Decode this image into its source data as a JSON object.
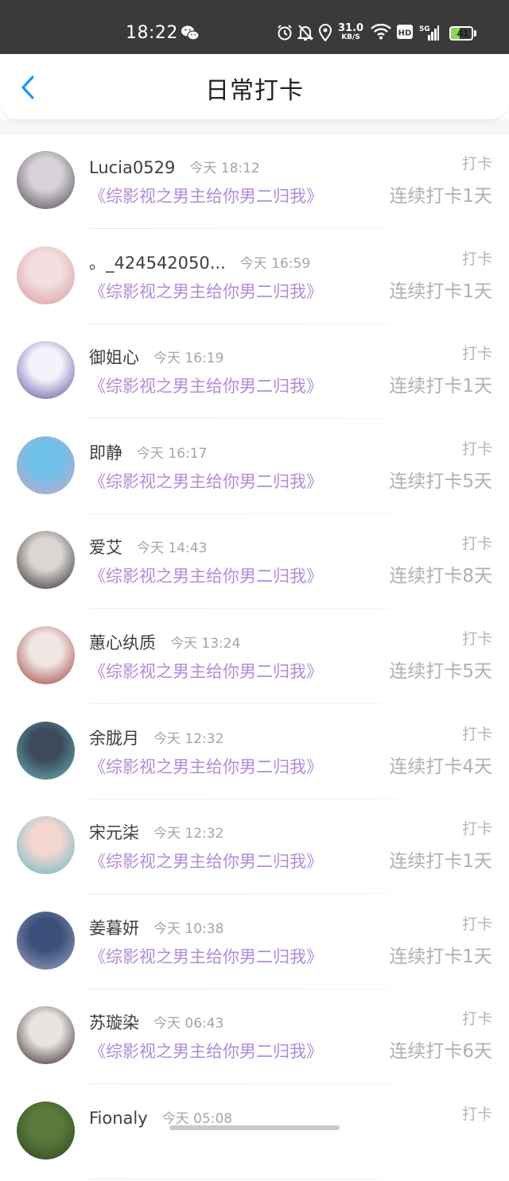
{
  "status_bar": {
    "time": "18:22",
    "net_speed_value": "31.0",
    "net_speed_unit": "KB/S",
    "network_type": "5G",
    "hd_label": "HD",
    "battery_level": "41",
    "battery_fraction": 0.41,
    "icons": [
      "wechat-icon",
      "alarm-icon",
      "mute-bell-icon",
      "location-icon",
      "wifi-icon",
      "hd-icon",
      "signal-icon",
      "battery-icon"
    ]
  },
  "nav": {
    "title": "日常打卡",
    "back_icon": "chevron-left-icon",
    "accent_color": "#2196f3"
  },
  "colors": {
    "book_title": "#b28bd8",
    "secondary_text": "#a5a5a5"
  },
  "entries": [
    {
      "name": "Lucia0529",
      "time": "今天 18:12",
      "book": "《综影视之男主给你男二归我》",
      "action": "打卡",
      "streak": "连续打卡1天",
      "avatar_colors": [
        "#d7d3d8",
        "#4b4550"
      ]
    },
    {
      "name": "。_424542050...",
      "time": "今天 16:59",
      "book": "《综影视之男主给你男二归我》",
      "action": "打卡",
      "streak": "连续打卡1天",
      "avatar_colors": [
        "#f3dfe0",
        "#d6969d"
      ]
    },
    {
      "name": "御姐心",
      "time": "今天 16:19",
      "book": "《综影视之男主给你男二归我》",
      "action": "打卡",
      "streak": "连续打卡1天",
      "avatar_colors": [
        "#f4f3fb",
        "#5b4a9a"
      ]
    },
    {
      "name": "即静",
      "time": "今天 16:17",
      "book": "《综影视之男主给你男二归我》",
      "action": "打卡",
      "streak": "连续打卡5天",
      "avatar_colors": [
        "#6fc0e8",
        "#c7a6c8"
      ]
    },
    {
      "name": "爱艾",
      "time": "今天 14:43",
      "book": "《综影视之男主给你男二归我》",
      "action": "打卡",
      "streak": "连续打卡8天",
      "avatar_colors": [
        "#d9d6d4",
        "#2a2625"
      ]
    },
    {
      "name": "蕙心纨质",
      "time": "今天 13:24",
      "book": "《综影视之男主给你男二归我》",
      "action": "打卡",
      "streak": "连续打卡5天",
      "avatar_colors": [
        "#f0e6e4",
        "#9b3a36"
      ]
    },
    {
      "name": "余胧月",
      "time": "今天 12:32",
      "book": "《综影视之男主给你男二归我》",
      "action": "打卡",
      "streak": "连续打卡4天",
      "avatar_colors": [
        "#3c4a5c",
        "#6db5b7"
      ]
    },
    {
      "name": "宋元柒",
      "time": "今天 12:32",
      "book": "《综影视之男主给你男二归我》",
      "action": "打卡",
      "streak": "连续打卡1天",
      "avatar_colors": [
        "#f2d6cf",
        "#5fb8c6"
      ]
    },
    {
      "name": "姜暮妍",
      "time": "今天 10:38",
      "book": "《综影视之男主给你男二归我》",
      "action": "打卡",
      "streak": "连续打卡1天",
      "avatar_colors": [
        "#3b4f7a",
        "#9aa6c2"
      ]
    },
    {
      "name": "苏璇染",
      "time": "今天 06:43",
      "book": "《综影视之男主给你男二归我》",
      "action": "打卡",
      "streak": "连续打卡6天",
      "avatar_colors": [
        "#e9e3e1",
        "#2b2323"
      ]
    },
    {
      "name": "Fionaly",
      "time": "今天 05:08",
      "book": "",
      "action": "打卡",
      "streak": "",
      "avatar_colors": [
        "#5a7a3c",
        "#2e4620"
      ]
    }
  ]
}
